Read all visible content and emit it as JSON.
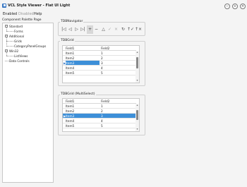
{
  "window": {
    "title": "VCL Style Viewer - Flat UI Light",
    "minimize_glyph": "−",
    "maximize_glyph": "+",
    "close_glyph": "×"
  },
  "menu": {
    "enabled": "Enabled",
    "disabled": "Disabled",
    "help": "Help"
  },
  "palette": {
    "label": "Component Palette Page",
    "items": [
      {
        "label": "Standard",
        "expanded": true
      },
      {
        "label": "Forms"
      },
      {
        "label": "Additional",
        "expanded": true
      },
      {
        "label": "Grids"
      },
      {
        "label": "CategoryPanelGroups"
      },
      {
        "label": "Win32",
        "expanded": true
      },
      {
        "label": "ListViews"
      },
      {
        "label": "Data Controls"
      }
    ]
  },
  "navigator": {
    "title": "TDBNavigator",
    "buttons": [
      {
        "name": "first",
        "glyph": "|◁"
      },
      {
        "name": "prior",
        "glyph": "◁"
      },
      {
        "name": "next",
        "glyph": "▷"
      },
      {
        "name": "last",
        "glyph": "▷|"
      },
      {
        "name": "insert",
        "glyph": "+"
      },
      {
        "name": "delete",
        "glyph": "−"
      },
      {
        "name": "edit",
        "glyph": "△"
      },
      {
        "name": "post",
        "glyph": "✓"
      },
      {
        "name": "cancel",
        "glyph": "×"
      },
      {
        "name": "refresh",
        "glyph": "↻"
      },
      {
        "name": "apply-updates",
        "glyph": "↑✓"
      },
      {
        "name": "cancel-updates",
        "glyph": "↑×"
      }
    ]
  },
  "grid1": {
    "title": "TDBGrid",
    "columns": [
      "Field1",
      "Field2"
    ],
    "rows": [
      [
        "Item1",
        "1"
      ],
      [
        "Item2",
        "2"
      ],
      [
        "Item3",
        "3"
      ],
      [
        "Item4",
        "4"
      ],
      [
        "Item5",
        "5"
      ]
    ],
    "selected_row": 2
  },
  "grid2": {
    "title": "TDBGrid (MultiSelect)",
    "columns": [
      "Field1",
      "Field2"
    ],
    "rows": [
      [
        "Item1",
        "1"
      ],
      [
        "Item2",
        "2"
      ],
      [
        "Item3",
        "3"
      ],
      [
        "Item4",
        "4"
      ],
      [
        "Item5",
        "5"
      ]
    ],
    "selected_row": 2
  },
  "colors": {
    "selection": "#3d8fd8",
    "indicator": "#3a78c3"
  }
}
